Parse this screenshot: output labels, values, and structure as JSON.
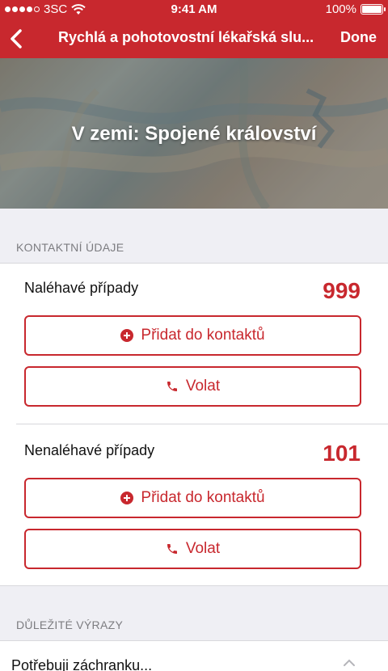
{
  "status_bar": {
    "carrier": "3SC",
    "time": "9:41 AM",
    "battery": "100%",
    "signal_icon": "signal-dots-icon",
    "wifi_icon": "wifi-icon",
    "battery_icon": "battery-icon"
  },
  "nav": {
    "title": "Rychlá a pohotovostní lékařská slu...",
    "done_label": "Done",
    "back_icon": "chevron-left-icon"
  },
  "hero": {
    "title": "V zemi: Spojené království"
  },
  "contacts": {
    "header": "KONTAKTNÍ ÚDAJE",
    "items": [
      {
        "label": "Naléhavé případy",
        "number": "999",
        "add_label": "Přidat do kontaktů",
        "call_label": "Volat"
      },
      {
        "label": "Nenaléhavé případy",
        "number": "101",
        "add_label": "Přidat do kontaktů",
        "call_label": "Volat"
      }
    ]
  },
  "phrases": {
    "header": "DŮLEŽITÉ VÝRAZY",
    "first_item": "Potřebuji záchranku..."
  },
  "colors": {
    "accent": "#c8282e",
    "background": "#efeff4"
  }
}
